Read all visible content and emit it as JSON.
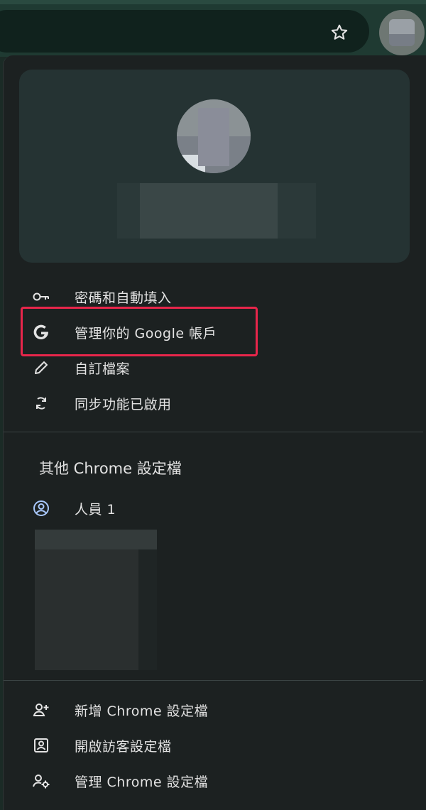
{
  "toolbar": {
    "bookmark_icon": "star-outline-icon",
    "profile_icon": "profile-avatar-icon"
  },
  "menu": {
    "items": [
      {
        "icon": "key-icon",
        "label": "密碼和自動填入"
      },
      {
        "icon": "google-g-icon",
        "label": "管理你的 Google 帳戶"
      },
      {
        "icon": "pencil-icon",
        "label": "自訂檔案"
      },
      {
        "icon": "sync-icon",
        "label": "同步功能已啟用"
      }
    ],
    "other_profiles_title": "其他 Chrome 設定檔",
    "profiles": [
      {
        "icon": "person-circle-icon",
        "label": "人員 1"
      }
    ],
    "footer_items": [
      {
        "icon": "person-add-icon",
        "label": "新增 Chrome 設定檔"
      },
      {
        "icon": "guest-profile-icon",
        "label": "開啟訪客設定檔"
      },
      {
        "icon": "manage-profiles-icon",
        "label": "管理 Chrome 設定檔"
      }
    ]
  },
  "colors": {
    "background": "#1c2121",
    "card": "#253333",
    "text": "#e3e3e3",
    "highlight": "#e8264b"
  }
}
